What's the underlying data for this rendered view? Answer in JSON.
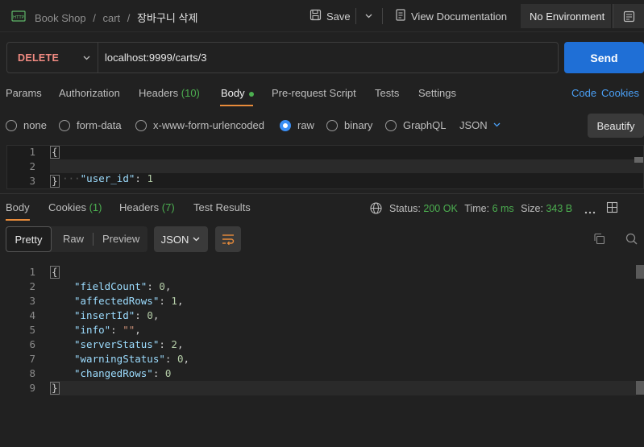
{
  "topbar": {
    "collection": "Book Shop",
    "separator": "/",
    "folder": "cart",
    "request_name": "장바구니 삭제",
    "save_label": "Save",
    "docs_label": "View Documentation",
    "environment": "No Environment"
  },
  "request": {
    "method": "DELETE",
    "url": "localhost:9999/carts/3",
    "send_label": "Send"
  },
  "request_tabs": {
    "params": "Params",
    "authorization": "Authorization",
    "headers": "Headers",
    "headers_count": "(10)",
    "body": "Body",
    "prerequest": "Pre-request Script",
    "tests": "Tests",
    "settings": "Settings",
    "code": "Code",
    "cookies": "Cookies"
  },
  "body_modes": {
    "none": "none",
    "form_data": "form-data",
    "urlencoded": "x-www-form-urlencoded",
    "raw": "raw",
    "binary": "binary",
    "graphql": "GraphQL",
    "format": "JSON",
    "beautify": "Beautify"
  },
  "request_body": {
    "line_numbers": [
      "1",
      "2",
      "3"
    ],
    "open": "{",
    "key": "\"user_id\"",
    "colon": ": ",
    "value": "1",
    "close": "}"
  },
  "response_tabs": {
    "body": "Body",
    "cookies": "Cookies",
    "cookies_count": "(1)",
    "headers": "Headers",
    "headers_count": "(7)",
    "test_results": "Test Results"
  },
  "response_status": {
    "status_label": "Status:",
    "status_value": "200 OK",
    "time_label": "Time:",
    "time_value": "6 ms",
    "size_label": "Size:",
    "size_value": "343 B"
  },
  "view_modes": {
    "pretty": "Pretty",
    "raw": "Raw",
    "preview": "Preview",
    "format": "JSON"
  },
  "response_body": {
    "line_numbers": [
      "1",
      "2",
      "3",
      "4",
      "5",
      "6",
      "7",
      "8",
      "9"
    ],
    "open": "{",
    "close": "}",
    "fields": [
      {
        "key": "\"fieldCount\"",
        "value": "0",
        "comma": ","
      },
      {
        "key": "\"affectedRows\"",
        "value": "1",
        "comma": ","
      },
      {
        "key": "\"insertId\"",
        "value": "0",
        "comma": ","
      },
      {
        "key": "\"info\"",
        "value": "\"\"",
        "comma": ","
      },
      {
        "key": "\"serverStatus\"",
        "value": "2",
        "comma": ","
      },
      {
        "key": "\"warningStatus\"",
        "value": "0",
        "comma": ","
      },
      {
        "key": "\"changedRows\"",
        "value": "0",
        "comma": ""
      }
    ]
  },
  "colors": {
    "accent_orange": "#e88b3a",
    "send_blue": "#1f6fd6",
    "method_red": "#f28b82",
    "status_green": "#4caf50",
    "link_blue": "#4a9ff5"
  },
  "icons": [
    "http-icon",
    "save-icon",
    "chevron-down-icon",
    "document-icon",
    "env-quicklook-icon",
    "globe-icon",
    "more-icon",
    "layout-icon",
    "wrap-lines-icon",
    "copy-icon",
    "search-icon"
  ]
}
